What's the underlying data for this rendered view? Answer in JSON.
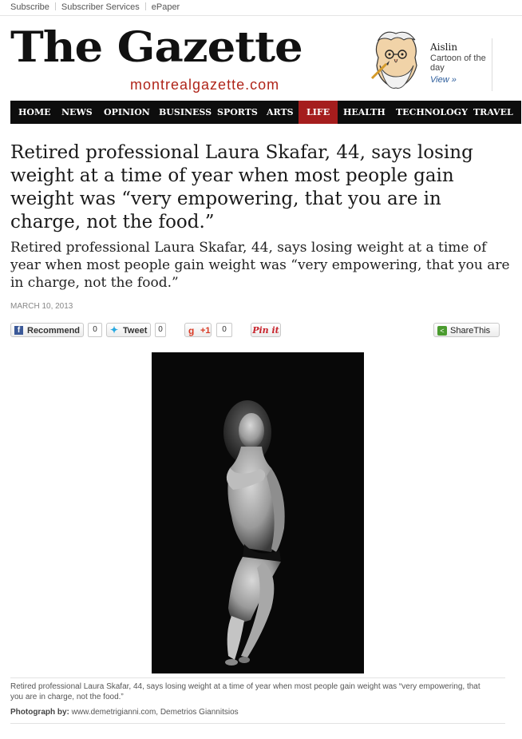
{
  "toplinks": [
    "Subscribe",
    "Subscriber Services",
    "ePaper"
  ],
  "masthead": {
    "logo": "The Gazette",
    "url": "montrealgazette.com"
  },
  "aislin": {
    "title": "Aislin",
    "subtitle": "Cartoon of the day",
    "view": "View »"
  },
  "nav": [
    "HOME",
    "NEWS",
    "OPINION",
    "BUSINESS",
    "SPORTS",
    "ARTS",
    "LIFE",
    "HEALTH",
    "TECHNOLOGY",
    "TRAVEL"
  ],
  "nav_active": "LIFE",
  "article": {
    "headline": "Retired professional Laura Skafar, 44, says losing weight at a time of year when most people gain weight was “very empowering, that you are in charge, not the food.”",
    "subhead": "Retired professional Laura Skafar, 44, says losing weight at a time of year when most people gain weight was “very empowering, that you are in charge, not the food.”",
    "date": "MARCH 10, 2013"
  },
  "share": {
    "facebook_label": "Recommend",
    "facebook_count": "0",
    "twitter_label": "Tweet",
    "twitter_count": "0",
    "gplus_label": "+1",
    "gplus_count": "0",
    "pinterest_label": "Pin it",
    "sharethis_label": "ShareThis"
  },
  "photo": {
    "caption": "Retired professional Laura Skafar, 44, says losing weight at a time of year when most people gain weight was “very empowering, that you are in charge, not the food.”",
    "credit_label": "Photograph by:",
    "credit_value": "www.demetrigianni.com, Demetrios Giannitsios"
  },
  "colors": {
    "nav_bg": "#0d0d0d",
    "nav_active": "#a51d1d",
    "brand_red": "#b0251a",
    "link_blue": "#2a5b9a"
  }
}
